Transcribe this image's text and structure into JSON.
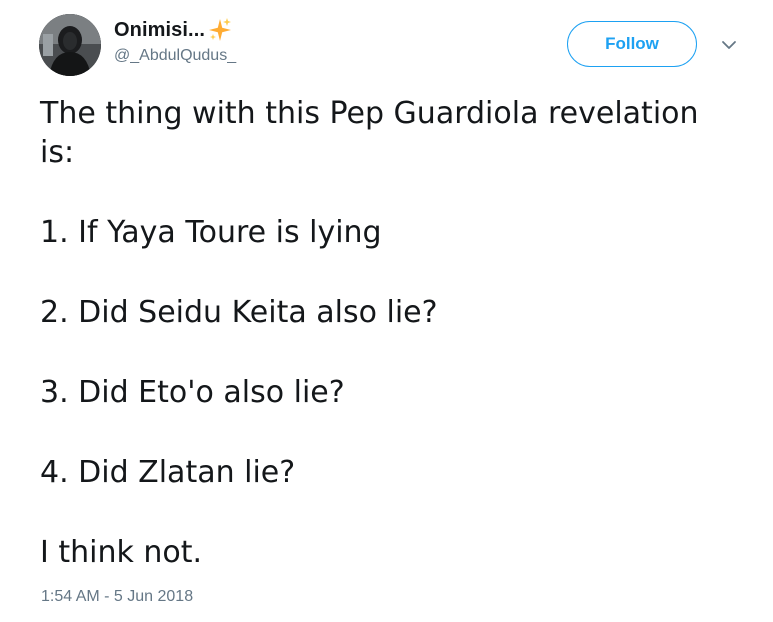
{
  "user": {
    "display_name": "Onimisi...",
    "handle": "@_AbdulQudus_"
  },
  "actions": {
    "follow_label": "Follow"
  },
  "tweet": {
    "lines": [
      "The thing with this Pep Guardiola revelation",
      "is:",
      "1. If Yaya Toure is lying",
      "2. Did Seidu Keita also lie?",
      "3. Did Eto'o also lie?",
      "4. Did Zlatan lie?",
      "I think not."
    ],
    "timestamp": "1:54 AM - 5 Jun 2018"
  },
  "icons": {
    "emoji": "sparkles-icon",
    "menu": "chevron-down-icon"
  },
  "colors": {
    "accent": "#1da1f2",
    "text": "#14171a",
    "secondary": "#657786",
    "sparkle": "#ffac33"
  }
}
